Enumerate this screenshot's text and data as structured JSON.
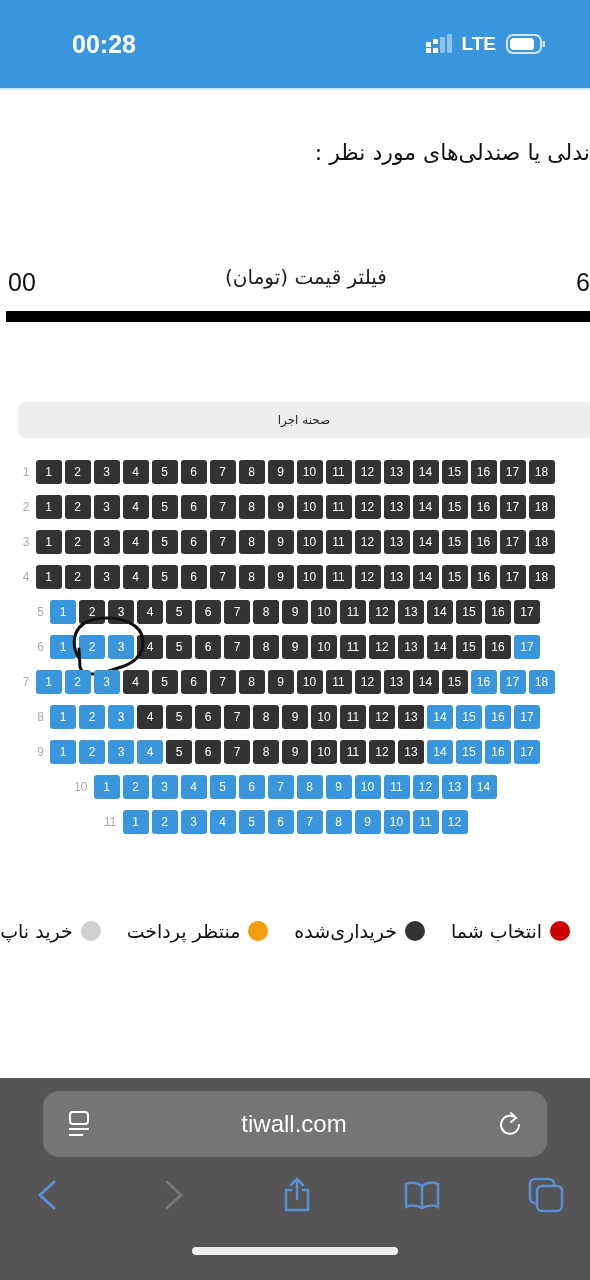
{
  "status_bar": {
    "time": "00:28",
    "network": "LTE"
  },
  "heading": "ندلی یا صندلی‌های مورد نظر :",
  "price_filter": {
    "label": "فیلتر قیمت (تومان)",
    "min": "00",
    "max": "6"
  },
  "stage": "صحنه اجرا",
  "rows": [
    {
      "label": "1",
      "circled": false,
      "seats": [
        {
          "n": "18",
          "sold": true
        },
        {
          "n": "17",
          "sold": true
        },
        {
          "n": "16",
          "sold": true
        },
        {
          "n": "15",
          "sold": true
        },
        {
          "n": "14",
          "sold": true
        },
        {
          "n": "13",
          "sold": true
        },
        {
          "n": "12",
          "sold": true
        },
        {
          "n": "11",
          "sold": true
        },
        {
          "n": "10",
          "sold": true
        },
        {
          "n": "9",
          "sold": true
        },
        {
          "n": "8",
          "sold": true
        },
        {
          "n": "7",
          "sold": true
        },
        {
          "n": "6",
          "sold": true
        },
        {
          "n": "5",
          "sold": true
        },
        {
          "n": "4",
          "sold": true
        },
        {
          "n": "3",
          "sold": true
        },
        {
          "n": "2",
          "sold": true
        },
        {
          "n": "1",
          "sold": true
        }
      ]
    },
    {
      "label": "2",
      "circled": false,
      "seats": [
        {
          "n": "18",
          "sold": true
        },
        {
          "n": "17",
          "sold": true
        },
        {
          "n": "16",
          "sold": true
        },
        {
          "n": "15",
          "sold": true
        },
        {
          "n": "14",
          "sold": true
        },
        {
          "n": "13",
          "sold": true
        },
        {
          "n": "12",
          "sold": true
        },
        {
          "n": "11",
          "sold": true
        },
        {
          "n": "10",
          "sold": true
        },
        {
          "n": "9",
          "sold": true
        },
        {
          "n": "8",
          "sold": true
        },
        {
          "n": "7",
          "sold": true
        },
        {
          "n": "6",
          "sold": true
        },
        {
          "n": "5",
          "sold": true
        },
        {
          "n": "4",
          "sold": true
        },
        {
          "n": "3",
          "sold": true
        },
        {
          "n": "2",
          "sold": true
        },
        {
          "n": "1",
          "sold": true
        }
      ]
    },
    {
      "label": "3",
      "circled": false,
      "seats": [
        {
          "n": "18",
          "sold": true
        },
        {
          "n": "17",
          "sold": true
        },
        {
          "n": "16",
          "sold": true
        },
        {
          "n": "15",
          "sold": true
        },
        {
          "n": "14",
          "sold": true
        },
        {
          "n": "13",
          "sold": true
        },
        {
          "n": "12",
          "sold": true
        },
        {
          "n": "11",
          "sold": true
        },
        {
          "n": "10",
          "sold": true
        },
        {
          "n": "9",
          "sold": true
        },
        {
          "n": "8",
          "sold": true
        },
        {
          "n": "7",
          "sold": true
        },
        {
          "n": "6",
          "sold": true
        },
        {
          "n": "5",
          "sold": true
        },
        {
          "n": "4",
          "sold": true
        },
        {
          "n": "3",
          "sold": true
        },
        {
          "n": "2",
          "sold": true
        },
        {
          "n": "1",
          "sold": true
        }
      ]
    },
    {
      "label": "4",
      "circled": false,
      "seats": [
        {
          "n": "18",
          "sold": true
        },
        {
          "n": "17",
          "sold": true
        },
        {
          "n": "16",
          "sold": true
        },
        {
          "n": "15",
          "sold": true
        },
        {
          "n": "14",
          "sold": true
        },
        {
          "n": "13",
          "sold": true
        },
        {
          "n": "12",
          "sold": true
        },
        {
          "n": "11",
          "sold": true
        },
        {
          "n": "10",
          "sold": true
        },
        {
          "n": "9",
          "sold": true
        },
        {
          "n": "8",
          "sold": true
        },
        {
          "n": "7",
          "sold": true
        },
        {
          "n": "6",
          "sold": true
        },
        {
          "n": "5",
          "sold": true
        },
        {
          "n": "4",
          "sold": true
        },
        {
          "n": "3",
          "sold": true
        },
        {
          "n": "2",
          "sold": true
        },
        {
          "n": "1",
          "sold": true
        }
      ]
    },
    {
      "label": "5",
      "circled": false,
      "seats": [
        {
          "n": "17",
          "sold": true
        },
        {
          "n": "16",
          "sold": true
        },
        {
          "n": "15",
          "sold": true
        },
        {
          "n": "14",
          "sold": true
        },
        {
          "n": "13",
          "sold": true
        },
        {
          "n": "12",
          "sold": true
        },
        {
          "n": "11",
          "sold": true
        },
        {
          "n": "10",
          "sold": true
        },
        {
          "n": "9",
          "sold": true
        },
        {
          "n": "8",
          "sold": true
        },
        {
          "n": "7",
          "sold": true
        },
        {
          "n": "6",
          "sold": true
        },
        {
          "n": "5",
          "sold": true
        },
        {
          "n": "4",
          "sold": true
        },
        {
          "n": "3",
          "sold": true
        },
        {
          "n": "2",
          "sold": true
        },
        {
          "n": "1",
          "sold": false
        }
      ]
    },
    {
      "label": "6",
      "circled": true,
      "seats": [
        {
          "n": "17",
          "sold": false
        },
        {
          "n": "16",
          "sold": true
        },
        {
          "n": "15",
          "sold": true
        },
        {
          "n": "14",
          "sold": true
        },
        {
          "n": "13",
          "sold": true
        },
        {
          "n": "12",
          "sold": true
        },
        {
          "n": "11",
          "sold": true
        },
        {
          "n": "10",
          "sold": true
        },
        {
          "n": "9",
          "sold": true
        },
        {
          "n": "8",
          "sold": true
        },
        {
          "n": "7",
          "sold": true
        },
        {
          "n": "6",
          "sold": true
        },
        {
          "n": "5",
          "sold": true
        },
        {
          "n": "4",
          "sold": true
        },
        {
          "n": "3",
          "sold": false
        },
        {
          "n": "2",
          "sold": false
        },
        {
          "n": "1",
          "sold": false
        }
      ]
    },
    {
      "label": "7",
      "circled": false,
      "seats": [
        {
          "n": "18",
          "sold": false
        },
        {
          "n": "17",
          "sold": false
        },
        {
          "n": "16",
          "sold": false
        },
        {
          "n": "15",
          "sold": true
        },
        {
          "n": "14",
          "sold": true
        },
        {
          "n": "13",
          "sold": true
        },
        {
          "n": "12",
          "sold": true
        },
        {
          "n": "11",
          "sold": true
        },
        {
          "n": "10",
          "sold": true
        },
        {
          "n": "9",
          "sold": true
        },
        {
          "n": "8",
          "sold": true
        },
        {
          "n": "7",
          "sold": true
        },
        {
          "n": "6",
          "sold": true
        },
        {
          "n": "5",
          "sold": true
        },
        {
          "n": "4",
          "sold": true
        },
        {
          "n": "3",
          "sold": false
        },
        {
          "n": "2",
          "sold": false
        },
        {
          "n": "1",
          "sold": false
        }
      ]
    },
    {
      "label": "8",
      "circled": false,
      "seats": [
        {
          "n": "17",
          "sold": false
        },
        {
          "n": "16",
          "sold": false
        },
        {
          "n": "15",
          "sold": false
        },
        {
          "n": "14",
          "sold": false
        },
        {
          "n": "13",
          "sold": true
        },
        {
          "n": "12",
          "sold": true
        },
        {
          "n": "11",
          "sold": true
        },
        {
          "n": "10",
          "sold": true
        },
        {
          "n": "9",
          "sold": true
        },
        {
          "n": "8",
          "sold": true
        },
        {
          "n": "7",
          "sold": true
        },
        {
          "n": "6",
          "sold": true
        },
        {
          "n": "5",
          "sold": true
        },
        {
          "n": "4",
          "sold": true
        },
        {
          "n": "3",
          "sold": false
        },
        {
          "n": "2",
          "sold": false
        },
        {
          "n": "1",
          "sold": false
        }
      ]
    },
    {
      "label": "9",
      "circled": false,
      "seats": [
        {
          "n": "17",
          "sold": false
        },
        {
          "n": "16",
          "sold": false
        },
        {
          "n": "15",
          "sold": false
        },
        {
          "n": "14",
          "sold": false
        },
        {
          "n": "13",
          "sold": true
        },
        {
          "n": "12",
          "sold": true
        },
        {
          "n": "11",
          "sold": true
        },
        {
          "n": "10",
          "sold": true
        },
        {
          "n": "9",
          "sold": true
        },
        {
          "n": "8",
          "sold": true
        },
        {
          "n": "7",
          "sold": true
        },
        {
          "n": "6",
          "sold": true
        },
        {
          "n": "5",
          "sold": true
        },
        {
          "n": "4",
          "sold": false
        },
        {
          "n": "3",
          "sold": false
        },
        {
          "n": "2",
          "sold": false
        },
        {
          "n": "1",
          "sold": false
        }
      ]
    },
    {
      "label": "10",
      "circled": false,
      "seats": [
        {
          "n": "14",
          "sold": false
        },
        {
          "n": "13",
          "sold": false
        },
        {
          "n": "12",
          "sold": false
        },
        {
          "n": "11",
          "sold": false
        },
        {
          "n": "10",
          "sold": false
        },
        {
          "n": "9",
          "sold": false
        },
        {
          "n": "8",
          "sold": false
        },
        {
          "n": "7",
          "sold": false
        },
        {
          "n": "6",
          "sold": false
        },
        {
          "n": "5",
          "sold": false
        },
        {
          "n": "4",
          "sold": false
        },
        {
          "n": "3",
          "sold": false
        },
        {
          "n": "2",
          "sold": false
        },
        {
          "n": "1",
          "sold": false
        }
      ]
    },
    {
      "label": "11",
      "circled": false,
      "seats": [
        {
          "n": "12",
          "sold": false
        },
        {
          "n": "11",
          "sold": false
        },
        {
          "n": "10",
          "sold": false
        },
        {
          "n": "9",
          "sold": false
        },
        {
          "n": "8",
          "sold": false
        },
        {
          "n": "7",
          "sold": false
        },
        {
          "n": "6",
          "sold": false
        },
        {
          "n": "5",
          "sold": false
        },
        {
          "n": "4",
          "sold": false
        },
        {
          "n": "3",
          "sold": false
        },
        {
          "n": "2",
          "sold": false
        },
        {
          "n": "1",
          "sold": false
        }
      ]
    }
  ],
  "legend": [
    {
      "label": "انتخاب شما",
      "color": "#cc0000"
    },
    {
      "label": "خریداری‌شده",
      "color": "#333333"
    },
    {
      "label": "منتظر پرداخت",
      "color": "#f59e0b"
    },
    {
      "label": "خرید ناپ",
      "color": "#d0d0d0"
    }
  ],
  "browser": {
    "url": "tiwall.com",
    "back_enabled": true,
    "forward_enabled": false
  }
}
